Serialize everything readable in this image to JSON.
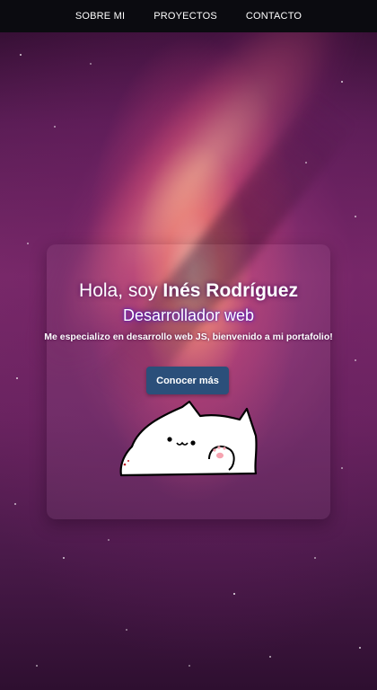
{
  "nav": {
    "items": [
      "SOBRE MI",
      "PROYECTOS",
      "CONTACTO"
    ]
  },
  "hero": {
    "greeting": "Hola, soy",
    "name": "Inés Rodríguez",
    "subtitle": "Desarrollador web",
    "description": "Me especializo en desarrollo web JS, bienvenido a mi portafolio!",
    "cta_label": "Conocer más"
  },
  "colors": {
    "nav_background": "#0b0b10",
    "button_background": "#2b4f7a",
    "subtitle_glow": "#4614c8"
  }
}
